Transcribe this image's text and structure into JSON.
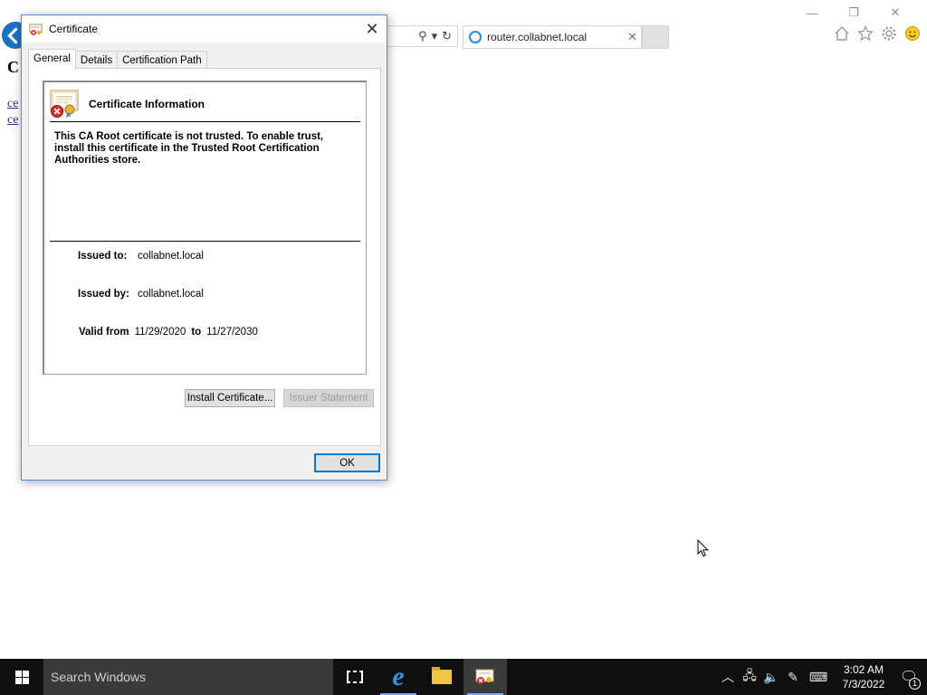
{
  "browser": {
    "window_controls": {
      "minimize": "—",
      "restore": "❐",
      "close": "✕"
    },
    "address_icons": {
      "search": "⚲",
      "dropdown": "▾",
      "refresh": "↻"
    },
    "tab": {
      "label": "router.collabnet.local",
      "close": "✕"
    },
    "toolbar_icons": [
      "home-icon",
      "favorites-star-icon",
      "settings-gear-icon",
      "feedback-smiley-icon"
    ],
    "page": {
      "heading": "C",
      "links": [
        "ce",
        "ce"
      ]
    }
  },
  "dialog": {
    "title": "Certificate",
    "close": "✕",
    "tabs": [
      "General",
      "Details",
      "Certification Path"
    ],
    "active_tab": "General",
    "info_title": "Certificate Information",
    "warning": "This CA Root certificate is not trusted. To enable trust, install this certificate in the Trusted Root Certification Authorities store.",
    "issued_to_label": "Issued to:",
    "issued_to": "collabnet.local",
    "issued_by_label": "Issued by:",
    "issued_by": "collabnet.local",
    "valid_from_label": "Valid from",
    "valid_from": "11/29/2020",
    "to_label": "to",
    "valid_to": "11/27/2030",
    "install_button": "Install Certificate...",
    "issuer_button": "Issuer Statement",
    "ok_button": "OK"
  },
  "taskbar": {
    "search_placeholder": "Search Windows",
    "apps": [
      "task-view",
      "internet-explorer",
      "file-explorer",
      "certificate"
    ],
    "tray_icons": {
      "chevron": "︿",
      "network": "🖧",
      "volume": "🔈",
      "pen": "✎",
      "keyboard": "⌨"
    },
    "time": "3:02 AM",
    "date": "7/3/2022",
    "notifications_count": "1"
  }
}
